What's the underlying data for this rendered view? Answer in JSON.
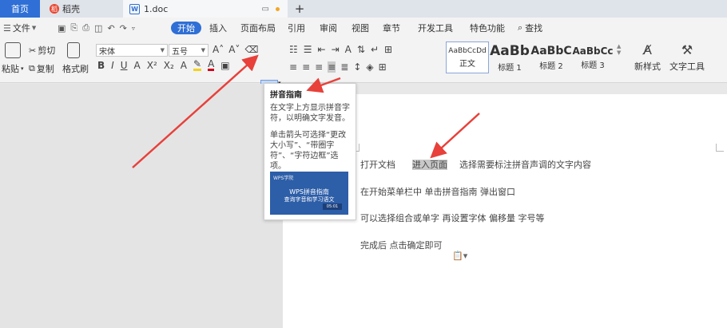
{
  "tabs": {
    "home": "首页",
    "daoke": "稻壳",
    "doc": "1.doc",
    "new_tab": "+"
  },
  "menu": {
    "file": "文件",
    "start": "开始",
    "items": [
      "插入",
      "页面布局",
      "引用",
      "审阅",
      "视图",
      "章节",
      "开发工具",
      "特色功能"
    ],
    "search": "查找"
  },
  "ribbon": {
    "paste": "粘贴",
    "cut": "剪切",
    "copy": "复制",
    "format_painter": "格式刷",
    "font_name": "宋体",
    "font_size": "五号",
    "pinyin_glyph": "变",
    "styles": [
      {
        "sample": "AaBbCcDd",
        "label": "正文"
      },
      {
        "sample": "AaBb",
        "label": "标题 1"
      },
      {
        "sample": "AaBbC",
        "label": "标题 2"
      },
      {
        "sample": "AaBbCc",
        "label": "标题 3"
      }
    ],
    "new_style": "新样式",
    "text_tools": "文字工具"
  },
  "tooltip": {
    "title": "拼音指南",
    "desc": "在文字上方显示拼音字符，以明确文字发音。",
    "desc2": "单击箭头可选择“更改大小写”、“带圈字符”、“字符边框”选项。",
    "img_logo": "WPS学院",
    "img_title": "WPS拼音指南",
    "img_subtitle": "查询字音和学习语文",
    "img_tag": "05:01"
  },
  "document": {
    "line1_pre": "打开文档",
    "line1_hl": "进入页面",
    "line1_post": "选择需要标注拼音声调的文字内容",
    "line2": "在开始菜单栏中   单击拼音指南   弹出窗口",
    "line3": "可以选择组合或单字   再设置字体   偏移量   字号等",
    "line4": "完成后   点击确定即可"
  },
  "colors": {
    "accent": "#2f6fd6",
    "arrow": "#e8403a"
  }
}
